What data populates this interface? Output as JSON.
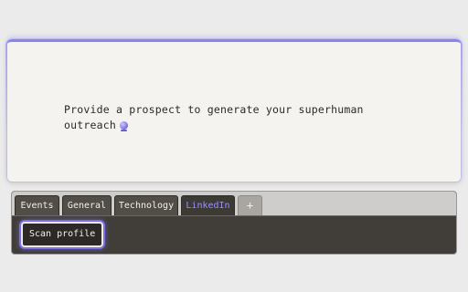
{
  "prompt": {
    "line1": "Provide a prospect to generate your superhuman",
    "line2": "outreach",
    "emoji_icon": "crystal-ball-icon"
  },
  "tabs": [
    {
      "label": "Events",
      "active": false
    },
    {
      "label": "General",
      "active": false
    },
    {
      "label": "Technology",
      "active": false
    },
    {
      "label": "LinkedIn",
      "active": true
    },
    {
      "label": "+",
      "active": false
    }
  ],
  "actions": {
    "scan_label": "Scan profile"
  },
  "colors": {
    "accent": "#8a84f0",
    "panel_bg": "#413d38",
    "active_tab_text": "#9b90ff"
  }
}
